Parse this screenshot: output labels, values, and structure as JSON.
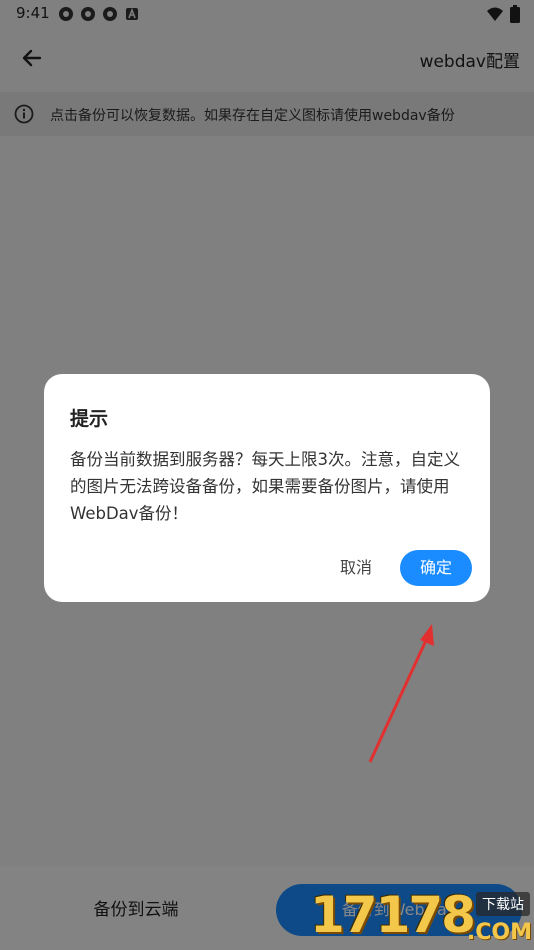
{
  "status_bar": {
    "time": "9:41",
    "icons": [
      "settings-gear-icon",
      "settings-gear-icon",
      "settings-gear-icon",
      "android-a-icon"
    ],
    "right_icons": [
      "wifi-icon",
      "battery-icon"
    ]
  },
  "app_bar": {
    "back_icon": "back-arrow-icon",
    "title": "webdav配置"
  },
  "notice": {
    "icon": "info-icon",
    "text": "点击备份可以恢复数据。如果存在自定义图标请使用webdav备份"
  },
  "bottom_bar": {
    "backup_cloud_label": "备份到云端",
    "backup_webdav_label": "备份到WebDav"
  },
  "dialog": {
    "title": "提示",
    "message": "备份当前数据到服务器？每天上限3次。注意，自定义的图片无法跨设备备份，如果需要备份图片，请使用WebDav备份！",
    "cancel_label": "取消",
    "confirm_label": "确定"
  },
  "annotation": {
    "arrow_icon": "red-arrow-icon",
    "color": "#e23030"
  },
  "watermark": {
    "number": "17178",
    "site_label": "下载站",
    "domain": ".COM"
  },
  "colors": {
    "accent": "#1a8cff",
    "background": "#f2f2f2",
    "notice_bg": "#e4e4e4"
  }
}
